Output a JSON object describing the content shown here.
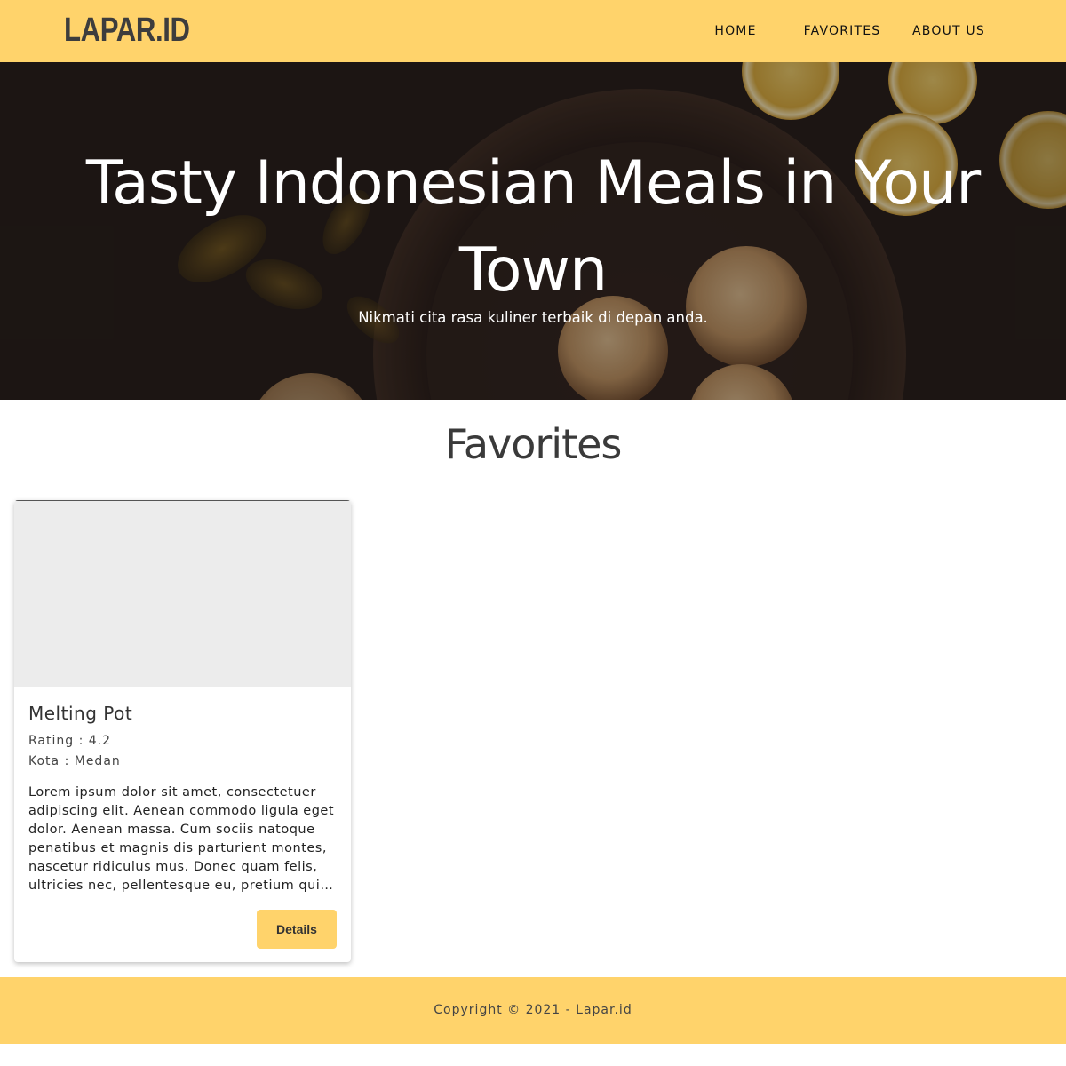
{
  "header": {
    "logo": "LAPAR.ID",
    "nav": [
      {
        "label": "HOME"
      },
      {
        "label": "FAVORITES"
      },
      {
        "label": "ABOUT US"
      }
    ]
  },
  "hero": {
    "title": "Tasty Indonesian Meals in Your Town",
    "subtitle": "Nikmati cita rasa kuliner terbaik di depan anda."
  },
  "favorites": {
    "heading": "Favorites",
    "restaurants": [
      {
        "name": "Melting Pot",
        "rating": "Rating : 4.2",
        "city": "Kota : Medan",
        "description": "Lorem ipsum dolor sit amet, consectetuer adipiscing elit. Aenean commodo ligula eget dolor. Aenean massa. Cum sociis natoque penatibus et magnis dis parturient montes, nascetur ridiculus mus. Donec quam felis, ultricies nec, pellentesque eu, pretium quis, sem.",
        "button_label": "Details"
      }
    ]
  },
  "footer": {
    "copyright": "Copyright © 2021 - Lapar.id"
  },
  "colors": {
    "brand_yellow": "#ffd36b",
    "hero_dark": "#1e1816",
    "placeholder_gray": "#ececec"
  }
}
